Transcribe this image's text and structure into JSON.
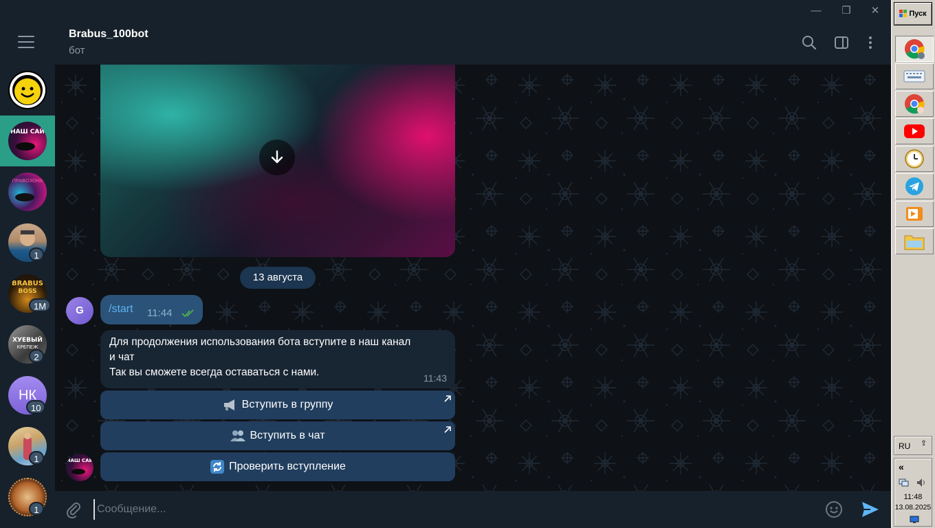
{
  "window": {
    "minimize": "—",
    "maximize": "❐",
    "close": "✕"
  },
  "header": {
    "title": "Brabus_100bot",
    "subtitle": "бот"
  },
  "sidebar": {
    "items": [
      {
        "name": "smiley",
        "badge": ""
      },
      {
        "name": "brabus-forum",
        "badge": ""
      },
      {
        "name": "brabus-2",
        "badge": ""
      },
      {
        "name": "man-photo",
        "badge": "1"
      },
      {
        "name": "brabus-boss",
        "badge": "1M"
      },
      {
        "name": "khuevyy",
        "badge": "2"
      },
      {
        "name": "nk",
        "initials": "НК",
        "badge": "10"
      },
      {
        "name": "woman-photo",
        "badge": "1"
      },
      {
        "name": "painting",
        "badge": "1"
      }
    ]
  },
  "chat": {
    "date": "13 августа",
    "user_initial": "G",
    "outgoing": {
      "text": "/start",
      "time": "11:44"
    },
    "incoming": {
      "line1": "Для продолжения использования бота вступите в наш канал",
      "line2": "и чат",
      "line3": "Так вы сможете всегда оставаться с нами.",
      "time": "11:43"
    },
    "buttons": {
      "join_group": "Вступить в группу",
      "join_chat": "Вступить в чат",
      "check": "Проверить вступление"
    }
  },
  "input": {
    "placeholder": "Сообщение..."
  },
  "taskbar": {
    "start": "Пуск",
    "lang": "RU",
    "collapse": "«",
    "time": "11:48",
    "date": "13.08.2025"
  },
  "colors": {
    "accent": "#2b9e88",
    "send": "#5eb5f7",
    "outgoing_bubble": "#2b5278",
    "incoming_bubble": "#182533",
    "button": "#213e5e"
  }
}
